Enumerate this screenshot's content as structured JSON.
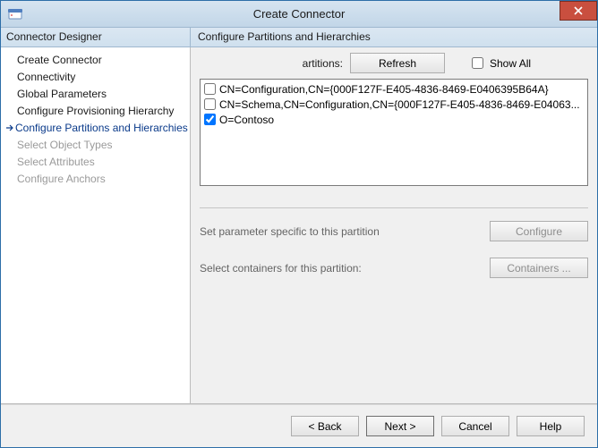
{
  "window": {
    "title": "Create Connector"
  },
  "sidebar": {
    "header": "Connector Designer",
    "items": [
      {
        "label": "Create Connector",
        "state": "done"
      },
      {
        "label": "Connectivity",
        "state": "done"
      },
      {
        "label": "Global Parameters",
        "state": "done"
      },
      {
        "label": "Configure Provisioning Hierarchy",
        "state": "done"
      },
      {
        "label": "Configure Partitions and Hierarchies",
        "state": "current"
      },
      {
        "label": "Select Object Types",
        "state": "disabled"
      },
      {
        "label": "Select Attributes",
        "state": "disabled"
      },
      {
        "label": "Configure Anchors",
        "state": "disabled"
      }
    ]
  },
  "main": {
    "header": "Configure Partitions and Hierarchies",
    "partitions_label": "artitions:",
    "refresh_label": "Refresh",
    "showall_label": "Show All",
    "showall_checked": false,
    "list": [
      {
        "checked": false,
        "label": "CN=Configuration,CN={000F127F-E405-4836-8469-E0406395B64A}"
      },
      {
        "checked": false,
        "label": "CN=Schema,CN=Configuration,CN={000F127F-E405-4836-8469-E04063..."
      },
      {
        "checked": true,
        "label": "O=Contoso"
      }
    ],
    "param_text": "Set parameter specific to this partition",
    "configure_label": "Configure",
    "containers_text": "Select containers for this partition:",
    "containers_label": "Containers ..."
  },
  "footer": {
    "back": "<  Back",
    "next": "Next  >",
    "cancel": "Cancel",
    "help": "Help"
  }
}
